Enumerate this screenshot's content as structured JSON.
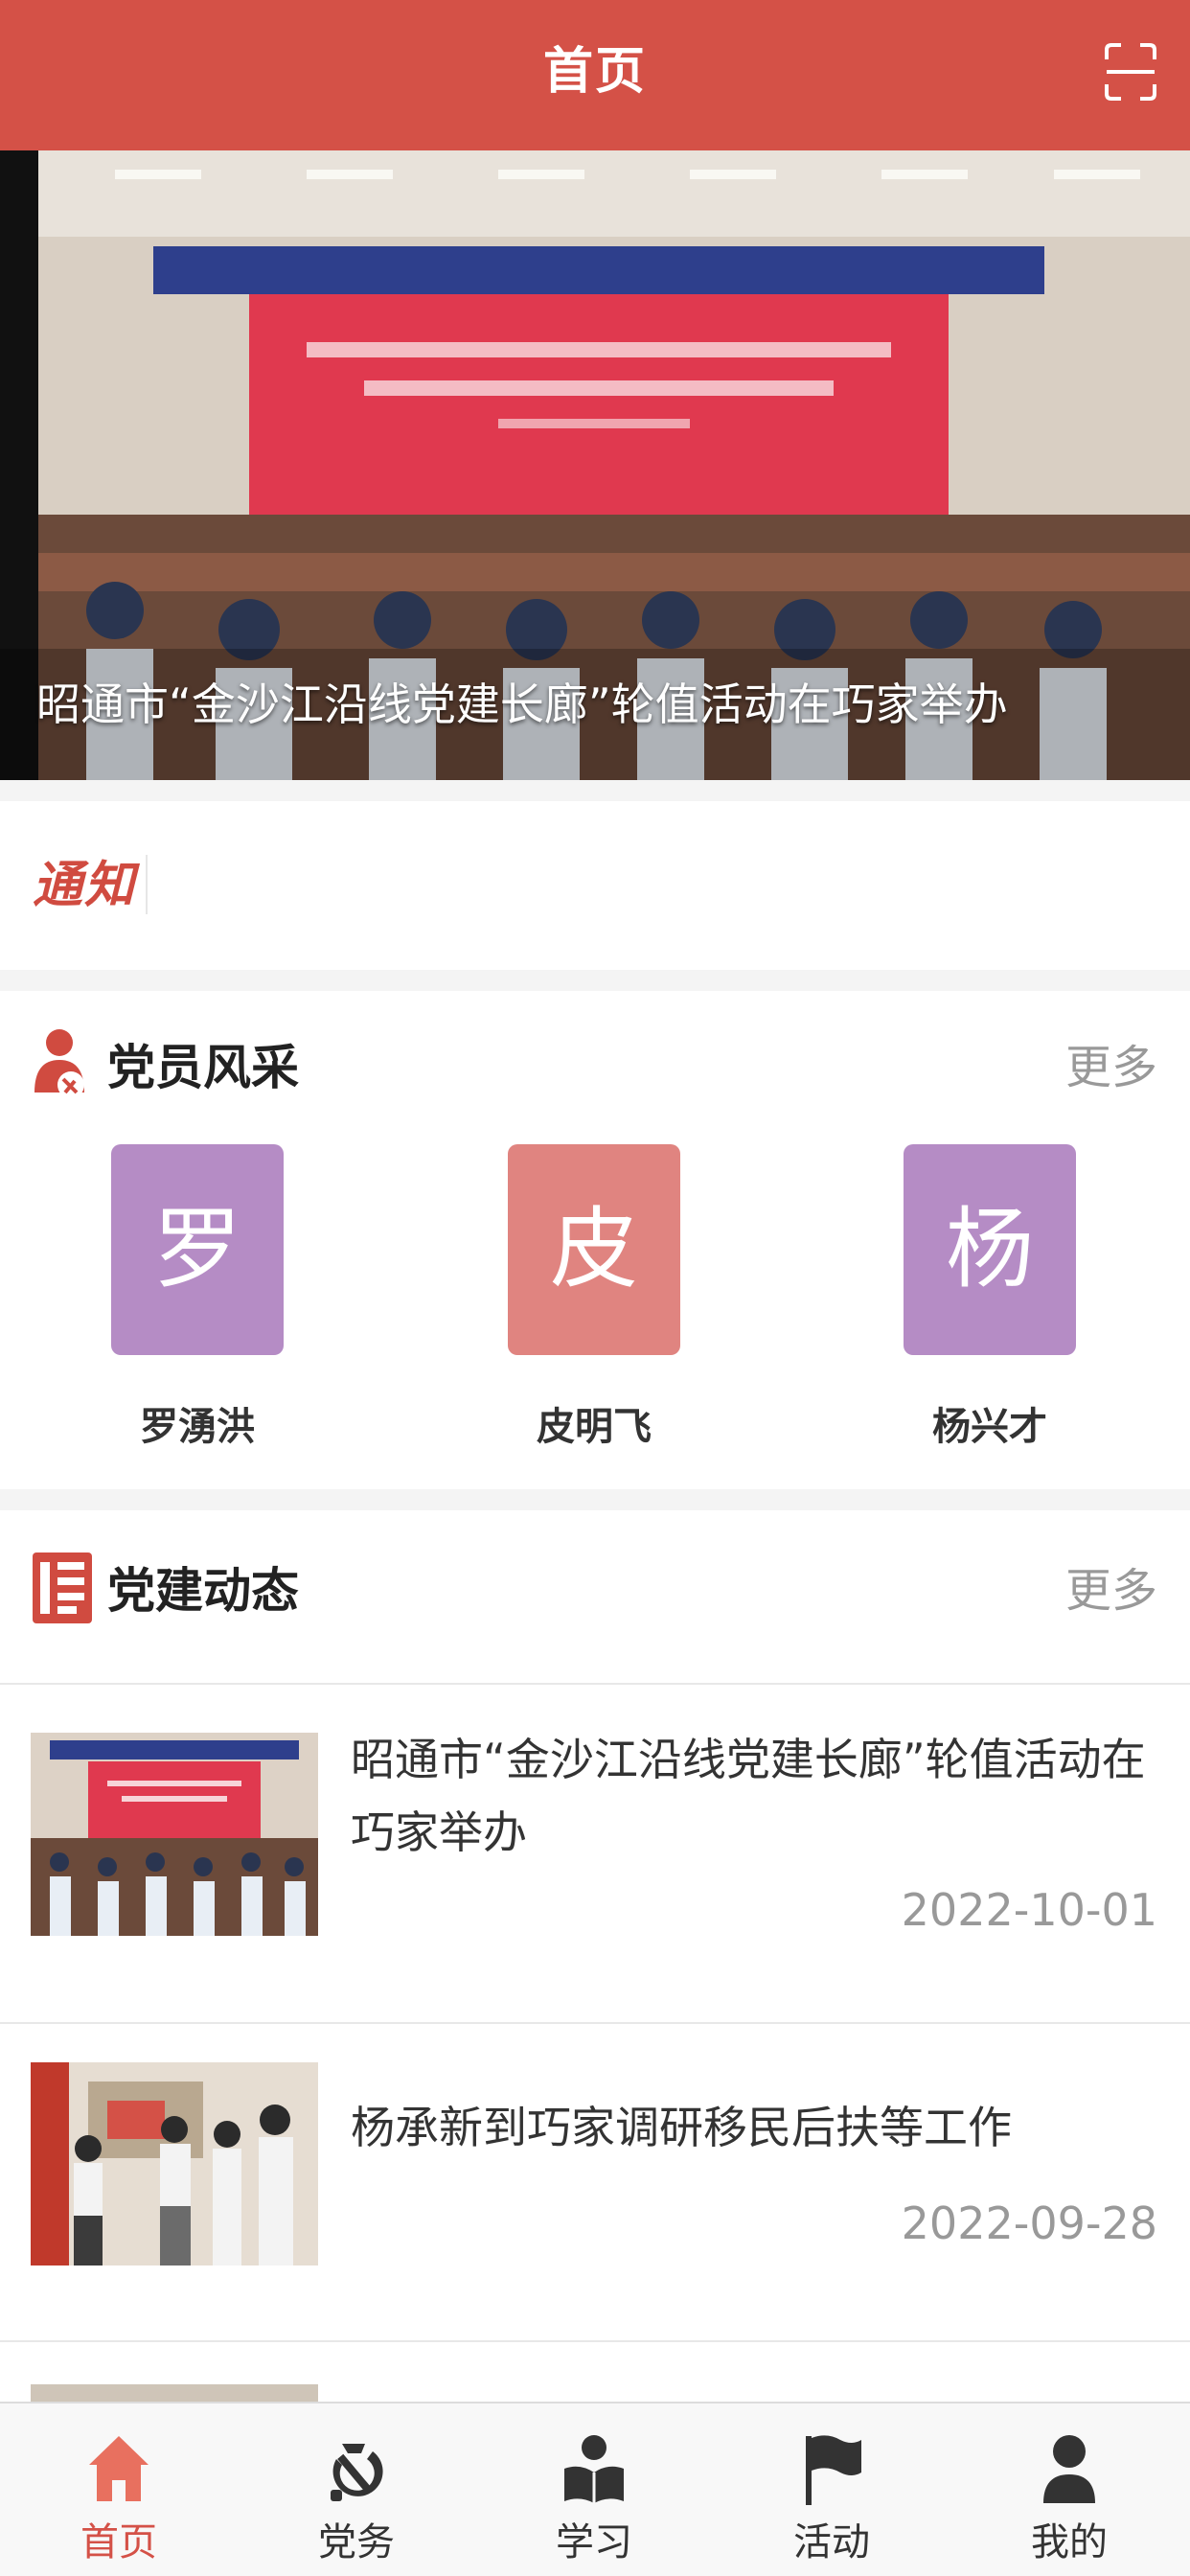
{
  "header": {
    "title": "首页"
  },
  "banner": {
    "caption": "昭通市“金沙江沿线党建长廊”轮值活动在巧家举办"
  },
  "notice": {
    "label": "通知"
  },
  "members_section": {
    "title": "党员风采",
    "more": "更多",
    "members": [
      {
        "initial": "罗",
        "name": "罗湧洪",
        "color": "#b58cc5"
      },
      {
        "initial": "皮",
        "name": "皮明飞",
        "color": "#e08480"
      },
      {
        "initial": "杨",
        "name": "杨兴才",
        "color": "#b58cc5"
      }
    ]
  },
  "news_section": {
    "title": "党建动态",
    "more": "更多",
    "items": [
      {
        "title": "昭通市“金沙江沿线党建长廊”轮值活动在巧家举办",
        "date": "2022-10-01"
      },
      {
        "title": "杨承新到巧家调研移民后扶等工作",
        "date": "2022-09-28"
      }
    ]
  },
  "tabbar": {
    "items": [
      {
        "label": "首页",
        "active": true
      },
      {
        "label": "党务",
        "active": false
      },
      {
        "label": "学习",
        "active": false
      },
      {
        "label": "活动",
        "active": false
      },
      {
        "label": "我的",
        "active": false
      }
    ]
  },
  "colors": {
    "brand": "#d45147",
    "avatar_purple": "#b58cc5",
    "avatar_pink": "#e08480"
  }
}
